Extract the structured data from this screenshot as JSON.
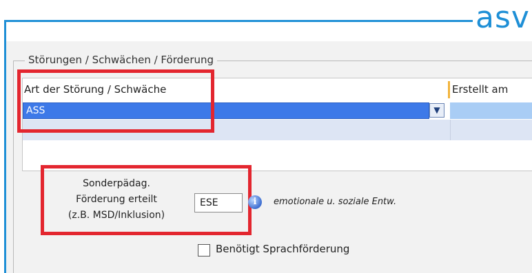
{
  "brand": {
    "logo_text": "asv",
    "accent": "#1e8fd6"
  },
  "group": {
    "title": "Störungen / Schwächen / Förderung"
  },
  "table": {
    "columns": [
      "Art der Störung / Schwäche",
      "Erstellt am"
    ],
    "rows": [
      {
        "art": "ASS",
        "erstellt_am": "",
        "selected": true
      }
    ],
    "dropdown_icon": "chevron-down-icon"
  },
  "foerderung": {
    "label_line1": "Sonderpädag.",
    "label_line2": "Förderung erteilt",
    "label_line3": "(z.B. MSD/Inklusion)",
    "value": "ESE",
    "info_icon": "info-icon",
    "info_text": "emotionale u. soziale Entw."
  },
  "sprachfoerderung": {
    "label": "Benötigt Sprachförderung",
    "checked": false
  },
  "highlight_color": "#e3262f"
}
